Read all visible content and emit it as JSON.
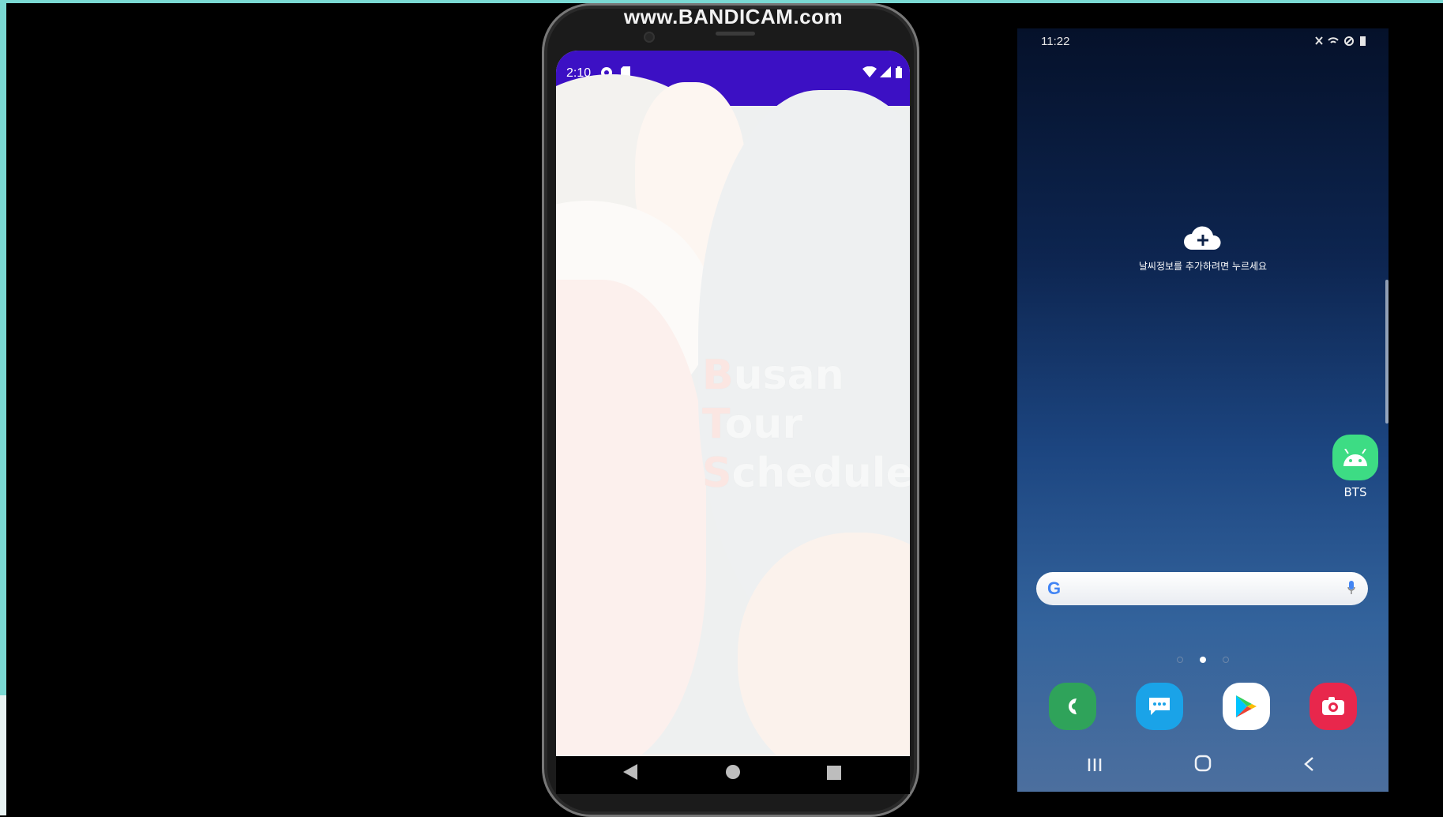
{
  "watermark": {
    "text": "www.BANDICAM.com"
  },
  "emulator": {
    "status_bar": {
      "time": "2:10",
      "color": "#3c10c4"
    },
    "splash": {
      "lines": [
        {
          "initial": "B",
          "rest": "usan"
        },
        {
          "initial": "T",
          "rest": "our"
        },
        {
          "initial": "S",
          "rest": "chedule"
        }
      ]
    },
    "nav": {
      "back_icon": "triangle-back-icon",
      "home_icon": "circle-home-icon",
      "recents_icon": "square-recents-icon"
    }
  },
  "device": {
    "status_bar": {
      "time": "11:22"
    },
    "weather_widget": {
      "icon": "cloud-add-icon",
      "prompt": "날씨정보를 추가하려면 누르세요"
    },
    "home_app": {
      "label": "BTS",
      "icon": "android-icon",
      "color": "#3ddc84"
    },
    "search": {
      "logo": "G",
      "mic_icon": "microphone-icon"
    },
    "page_indicator": {
      "count": 3,
      "active": 1
    },
    "dock": [
      {
        "name": "phone",
        "icon": "phone-icon",
        "color": "#2fa35a"
      },
      {
        "name": "messages",
        "icon": "message-icon",
        "color": "#1aa3e8"
      },
      {
        "name": "play-store",
        "icon": "play-store-icon",
        "color": "#ffffff"
      },
      {
        "name": "camera",
        "icon": "camera-icon",
        "color": "#e8274c"
      }
    ],
    "nav": {
      "recents": "III",
      "home": "O",
      "back": "<"
    }
  }
}
